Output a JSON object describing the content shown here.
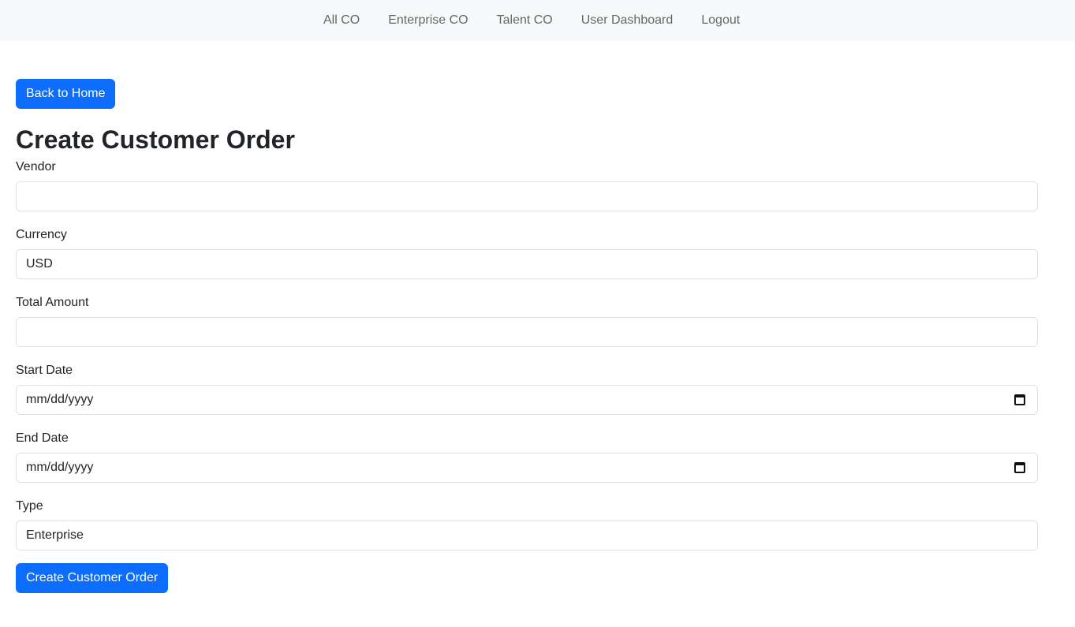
{
  "nav": {
    "items": [
      {
        "label": "All CO"
      },
      {
        "label": "Enterprise CO"
      },
      {
        "label": "Talent CO"
      },
      {
        "label": "User Dashboard"
      },
      {
        "label": "Logout"
      }
    ]
  },
  "back_button_label": "Back to Home",
  "page_title": "Create Customer Order",
  "form": {
    "vendor": {
      "label": "Vendor",
      "value": ""
    },
    "currency": {
      "label": "Currency",
      "value": "USD"
    },
    "total_amount": {
      "label": "Total Amount",
      "value": ""
    },
    "start_date": {
      "label": "Start Date",
      "placeholder": "mm/dd/yyyy",
      "icon": "calendar-icon"
    },
    "end_date": {
      "label": "End Date",
      "placeholder": "mm/dd/yyyy",
      "icon": "calendar-icon"
    },
    "type": {
      "label": "Type",
      "value": "Enterprise"
    },
    "submit_label": "Create Customer Order"
  },
  "colors": {
    "primary": "#0d6efd",
    "navbar_bg": "#f8f9fa",
    "border": "#dee2e6",
    "text": "#212529"
  }
}
